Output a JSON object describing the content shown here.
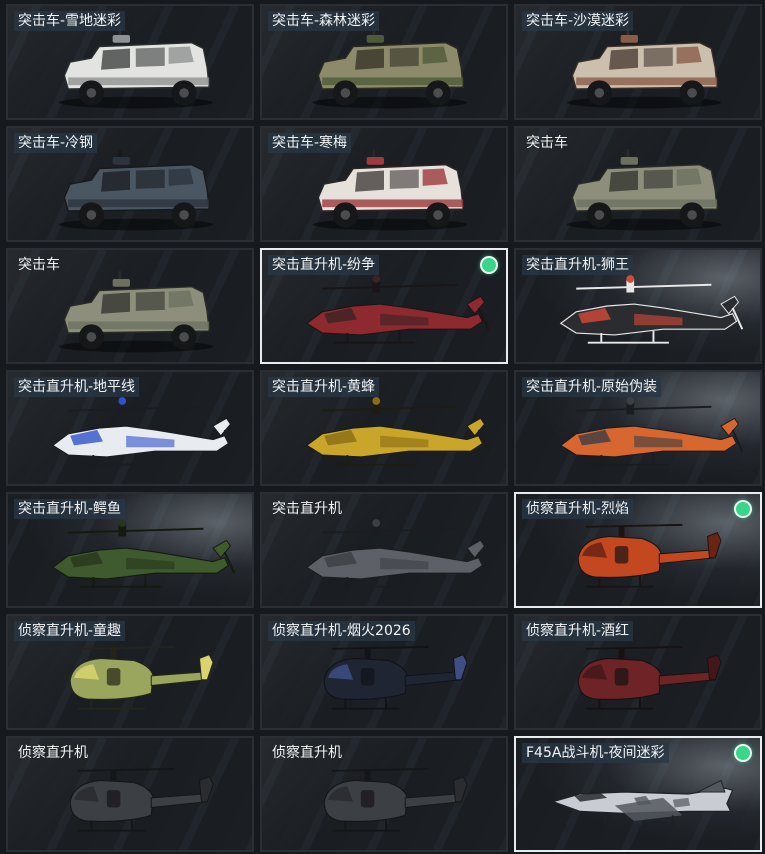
{
  "items": [
    {
      "label": "突击车-雪地迷彩",
      "kind": "truck",
      "c1": "#e3e4e2",
      "c2": "#8f9292",
      "c3": "#2b2d2e",
      "equipped": false,
      "selected": false,
      "tagged": true
    },
    {
      "label": "突击车-森林迷彩",
      "kind": "truck",
      "c1": "#8c8a6a",
      "c2": "#4f5a3a",
      "c3": "#2c2a20",
      "equipped": false,
      "selected": false,
      "tagged": true
    },
    {
      "label": "突击车-沙漠迷彩",
      "kind": "truck",
      "c1": "#cbbfae",
      "c2": "#8a5d4a",
      "c3": "#3a2c26",
      "equipped": false,
      "selected": false,
      "tagged": true
    },
    {
      "label": "突击车-冷钢",
      "kind": "truck",
      "c1": "#4b5663",
      "c2": "#2c343e",
      "c3": "#17191c",
      "equipped": false,
      "selected": false,
      "tagged": true
    },
    {
      "label": "突击车-寒梅",
      "kind": "truck",
      "c1": "#e7e1dc",
      "c2": "#9e3a3d",
      "c3": "#2c2627",
      "equipped": false,
      "selected": false,
      "tagged": true
    },
    {
      "label": "突击车",
      "kind": "truck",
      "c1": "#8d8f7c",
      "c2": "#6d705f",
      "c3": "#2a2b26",
      "equipped": false,
      "selected": false,
      "tagged": false
    },
    {
      "label": "突击车",
      "kind": "truck",
      "c1": "#8d8f7c",
      "c2": "#6d705f",
      "c3": "#2a2b26",
      "equipped": false,
      "selected": false,
      "tagged": false
    },
    {
      "label": "突击直升机-纷争",
      "kind": "attack",
      "c1": "#8e2a2f",
      "c2": "#3a2326",
      "c3": "#1a1516",
      "equipped": true,
      "selected": true,
      "tagged": true
    },
    {
      "label": "突击直升机-狮王",
      "kind": "attack",
      "c1": "#2a2c2f",
      "c2": "#d44a3a",
      "c3": "#e8e8e8",
      "equipped": false,
      "selected": false,
      "tagged": true
    },
    {
      "label": "突击直升机-地平线",
      "kind": "attack",
      "c1": "#e8ebf0",
      "c2": "#2f52c9",
      "c3": "#1b1d22",
      "equipped": false,
      "selected": false,
      "tagged": true
    },
    {
      "label": "突击直升机-黄蜂",
      "kind": "attack",
      "c1": "#c9a52a",
      "c2": "#8a6d16",
      "c3": "#1f1c12",
      "equipped": false,
      "selected": false,
      "tagged": true
    },
    {
      "label": "突击直升机-原始伪装",
      "kind": "attack",
      "c1": "#d8662f",
      "c2": "#3b3f46",
      "c3": "#1b1c1f",
      "equipped": false,
      "selected": false,
      "tagged": true
    },
    {
      "label": "突击直升机-鳄鱼",
      "kind": "attack",
      "c1": "#3f5a2e",
      "c2": "#28361d",
      "c3": "#151a10",
      "equipped": false,
      "selected": false,
      "tagged": true
    },
    {
      "label": "突击直升机",
      "kind": "attack",
      "c1": "#5d6066",
      "c2": "#3c3f44",
      "c3": "#1c1d20",
      "equipped": false,
      "selected": false,
      "tagged": false
    },
    {
      "label": "侦察直升机-烈焰",
      "kind": "scout",
      "c1": "#c3481f",
      "c2": "#6a2414",
      "c3": "#1a1412",
      "equipped": true,
      "selected": true,
      "tagged": true
    },
    {
      "label": "侦察直升机-童趣",
      "kind": "scout",
      "c1": "#9aa55d",
      "c2": "#d9d370",
      "c3": "#242518",
      "equipped": false,
      "selected": false,
      "tagged": true
    },
    {
      "label": "侦察直升机-烟火2026",
      "kind": "scout",
      "c1": "#1f2533",
      "c2": "#3f4f86",
      "c3": "#10131a",
      "equipped": false,
      "selected": false,
      "tagged": true
    },
    {
      "label": "侦察直升机-酒红",
      "kind": "scout",
      "c1": "#6e2326",
      "c2": "#43171a",
      "c3": "#161213",
      "equipped": false,
      "selected": false,
      "tagged": true
    },
    {
      "label": "侦察直升机",
      "kind": "scout",
      "c1": "#3c3f44",
      "c2": "#2a2c30",
      "c3": "#151618",
      "equipped": false,
      "selected": false,
      "tagged": false
    },
    {
      "label": "侦察直升机",
      "kind": "scout",
      "c1": "#3c3f44",
      "c2": "#2a2c30",
      "c3": "#151618",
      "equipped": false,
      "selected": false,
      "tagged": false
    },
    {
      "label": "F45A战斗机-夜间迷彩",
      "kind": "jet",
      "c1": "#c9cdd3",
      "c2": "#53575e",
      "c3": "#1f2126",
      "equipped": true,
      "selected": true,
      "tagged": true
    }
  ],
  "light_bg": [
    8,
    11,
    12,
    14,
    20
  ]
}
